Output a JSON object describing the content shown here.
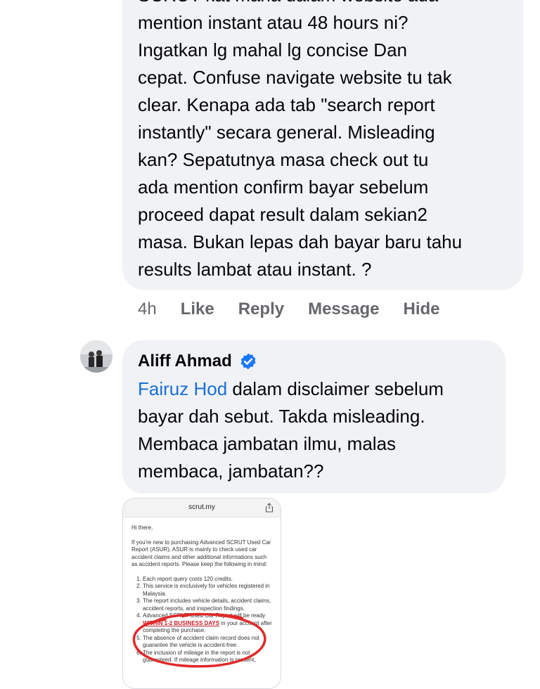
{
  "comment1": {
    "text": "SCRUT kat mana dalam website ada\nmention instant atau 48 hours ni?\nIngatkan lg mahal lg concise Dan\ncepat. Confuse navigate website tu tak\nclear. Kenapa ada tab \"search report\ninstantly\"  secara general. Misleading\nkan? Sepatutnya masa check out tu\nada mention confirm bayar sebelum\nproceed dapat result dalam sekian2\nmasa. Bukan lepas dah bayar baru tahu\nresults lambat atau instant. ?",
    "actions": {
      "time": "4h",
      "like": "Like",
      "reply": "Reply",
      "message": "Message",
      "hide": "Hide"
    }
  },
  "comment2": {
    "author": "Aliff Ahmad",
    "mention": "Fairuz Hod",
    "text": " dalam disclaimer sebelum\nbayar dah sebut. Takda misleading.\nMembaca jambatan ilmu, malas\nmembaca, jambatan??"
  },
  "screenshot": {
    "url": "scrut.my",
    "greeting": "Hi there,",
    "intro": "If you're new to purchasing Advanced SCRUT Used Car Report (ASUR), ASUR is mainly to check used car accident claims and other additional informations such as accident reports. Please keep the following in mind:",
    "items": [
      "Each report query costs 120 credits.",
      "This service is exclusively for vehicles registered in Malaysia.",
      "The report includes vehicle details, accident claims, accident reports, and inspection findings.",
      "Advanced SCRUT Used Car Report will be ready ",
      "The absence of accident claim record does not guarantee the vehicle is accident-free.",
      "The inclusion of mileage in the report is not guaranteed. If mileage information is present,"
    ],
    "highlight": "WITHIN 1-2 BUSINESS DAYS",
    "item4_tail": " in your account after completing the purchase."
  },
  "colors": {
    "bubble": "#f0f2f5",
    "mention": "#1a6ed8",
    "verified": "#1877f2",
    "annotation": "#e02a2a"
  }
}
